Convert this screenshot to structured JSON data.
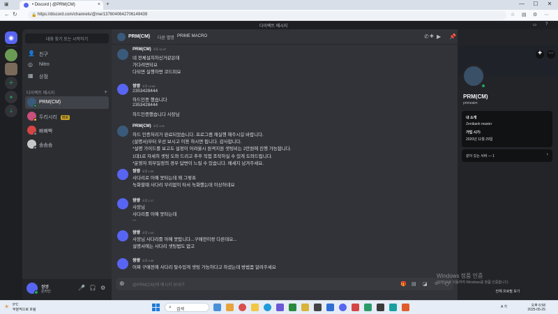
{
  "browser": {
    "tab_title": "• Discord | @PRM(CM)",
    "tab_close": "×",
    "url": "https://discord.com/channels/@me/1376040642706149439",
    "controls": {
      "min": "—",
      "max": "☐",
      "close": "✕"
    }
  },
  "discord": {
    "window_title": "다이렉트 메시지",
    "find_button": "대화 찾기 또는 시작하기",
    "nav": [
      {
        "label": "친구",
        "icon": "friends-icon"
      },
      {
        "label": "Nitro",
        "icon": "nitro-icon"
      },
      {
        "label": "상점",
        "icon": "shop-icon"
      }
    ],
    "dm_header": "다이렉트 메시지",
    "dm_plus": "+",
    "dms": [
      {
        "name": "PRM(CM)",
        "avatar_color": "#3a5a7a",
        "status_color": "#23a55a",
        "selected": true,
        "badge": ""
      },
      {
        "name": "두리시리",
        "avatar_color": "#c94f7c",
        "status_color": "#f0b232",
        "selected": false,
        "badge": "테르"
      },
      {
        "name": "빠빠빡",
        "avatar_color": "#d64545",
        "status_color": "#80848e",
        "selected": false,
        "badge": ""
      },
      {
        "name": "솜솜솜",
        "avatar_color": "#c7c7c7",
        "status_color": "#80848e",
        "selected": false,
        "badge": ""
      }
    ],
    "user": {
      "name": "쌍쌍",
      "status": "온라인"
    },
    "chat": {
      "header_name": "PRM(CM)",
      "header_mutual": "다른 별명",
      "header_server": "PRIME MACRO",
      "composer_placeholder": "@PRM(CM)에 메시지 보내기",
      "messages": [
        {
          "author": "PRM(CM)",
          "time": "오후 12:47",
          "avatar_color": "#3a5a7a",
          "lines": [
            "네 전체설치하신거같은데",
            "가다려면되요",
            "다되면 실행하면 코드피요"
          ]
        },
        {
          "author": "쌍쌍",
          "time": "오후 12:59",
          "avatar_color": "#5865f2",
          "lines": [
            "2353428444",
            "하드인증 했습니다",
            "2353428444",
            "하드인증했습니다 사장님"
          ]
        },
        {
          "author": "PRM(CM)",
          "time": "오후 1:01",
          "avatar_color": "#3a5a7a",
          "lines": [
            "하드 인증처리가 완료되었습니다. 프로그램 재실행 해주시길 바랍니다.",
            "(설명서)부터 우선 보시고 이용 하시면 됩니다. 감사합니다.",
            "*설명 가이드를 보고도 설정이 어려울시 원격지원 셋팅비는 2만원에 진행 가능합니다.",
            "1대1로 자세히 셋팅 도와 드리고 추후 직접 조작하실 수 있게 도와드립니다.",
            "*운영자 외부일정의 경우 답변이 느릴 수 있습니다. 메세지 남겨주세요."
          ]
        },
        {
          "author": "쌍쌍",
          "time": "오후 1:05",
          "avatar_color": "#5865f2",
          "lines": [
            "사다리로 아예 못타는데 왜 그렇죠",
            "녹화할때 사다리 무리없이 타서 녹화했는데 이상하네요"
          ]
        },
        {
          "author": "쌍쌍",
          "time": "오후 1:17",
          "avatar_color": "#5865f2",
          "lines": [
            "사장님",
            "사다리를 아예 못타는데",
            "..."
          ]
        },
        {
          "author": "쌍쌍",
          "time": "오후 1:40",
          "avatar_color": "#5865f2",
          "lines": [
            "사장님 사다리를 아예 못탑니다...구매전이랑 다른데요...",
            "설명서에는 사다리 셋팅법도 없고"
          ]
        },
        {
          "author": "쌍쌍",
          "time": "오후 4:36",
          "avatar_color": "#5865f2",
          "lines": [
            "어짜 구매전에 사다리 탈수있게 셋팅 가능하다고 하셨는데 방법좀 알려주세요"
          ]
        }
      ]
    },
    "profile": {
      "name": "PRM(CM)",
      "username": "primeaim",
      "about_label": "내 소개",
      "about_value": "Zenibank master",
      "joined_label": "가입 시기:",
      "joined_value": "2020년 11월 29일",
      "mutual": "같이 있는 서버 — 1",
      "full_profile": "전체 프로필 보기"
    },
    "activation": {
      "title": "Windows 정품 인증",
      "subtitle": "[설정]으로 이동하여 Windows를 정품 인증합니다."
    }
  },
  "taskbar": {
    "weather_temp": "9°C",
    "weather_desc": "부분적으로 흐림",
    "search": "검색",
    "time": "오후 6:58",
    "date": "2025-05-25",
    "lang": "A 가"
  }
}
